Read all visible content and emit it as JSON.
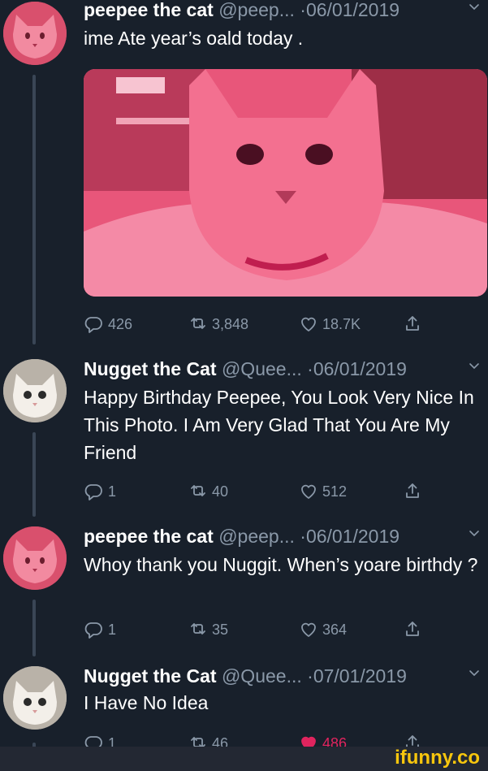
{
  "tweets": [
    {
      "name": "peepee the cat",
      "handle": "@peep...",
      "dot": "·",
      "date": "06/01/2019",
      "text": "ime Ate year’s oald today .",
      "replies": "426",
      "retweets": "3,848",
      "likes": "18.7K",
      "liked": false
    },
    {
      "name": "Nugget the Cat",
      "handle": "@Quee...",
      "dot": "·",
      "date": "06/01/2019",
      "text": "Happy Birthday Peepee, You Look Very Nice In This Photo. I Am Very Glad That You Are My Friend",
      "replies": "1",
      "retweets": "40",
      "likes": "512",
      "liked": false
    },
    {
      "name": "peepee the cat",
      "handle": "@peep...",
      "dot": "·",
      "date": "06/01/2019",
      "text": "Whoy thank you Nuggit. When’s yoare birthdy ?",
      "replies": "1",
      "retweets": "35",
      "likes": "364",
      "liked": false
    },
    {
      "name": "Nugget the Cat",
      "handle": "@Quee...",
      "dot": "·",
      "date": "07/01/2019",
      "text": "I Have No Idea",
      "replies": "1",
      "retweets": "46",
      "likes": "486",
      "liked": true
    }
  ],
  "icons": {
    "reply": "reply-icon",
    "retweet": "retweet-icon",
    "like": "heart-icon",
    "share": "share-icon",
    "menu": "chevron-down-icon"
  },
  "colors": {
    "background": "#18202b",
    "muted": "#8a98a8",
    "liked": "#e0245e",
    "watermark": "#f8c60d"
  },
  "watermark": "ifunny.co"
}
